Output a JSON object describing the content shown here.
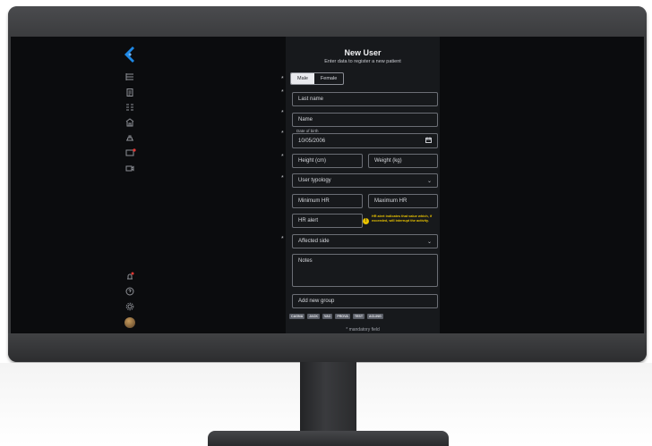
{
  "form": {
    "title": "New User",
    "subtitle": "Enter data to register a new patient",
    "gender_options": [
      "Male",
      "Female"
    ],
    "selected_gender": "Male",
    "required_marker": "*",
    "last_name_placeholder": "Last name",
    "name_placeholder": "Name",
    "date_of_birth_label": "Date of birth",
    "date_of_birth_value": "10/05/2006",
    "height_placeholder": "Height (cm)",
    "weight_placeholder": "Weight (kg)",
    "user_typology_placeholder": "User typology",
    "min_hr_placeholder": "Minimum HR",
    "max_hr_placeholder": "Maximum HR",
    "hr_alert_placeholder": "HR alert",
    "hr_alert_note": "HR alert indicates that value which, if exceeded, will interrupt the activity.",
    "affected_side_placeholder": "Affected side",
    "notes_placeholder": "Notes",
    "add_group_placeholder": "Add new group",
    "groups": [
      "CAGNA",
      "JACK",
      "VAC",
      "PROVA",
      "TEST",
      "ACLING"
    ],
    "footnote": "* mandatory field"
  },
  "icons": {
    "logo": "app-logo-icon",
    "sidebar": [
      "list-icon",
      "clipboard-icon",
      "tasks-icon",
      "building-icon",
      "device-icon",
      "monitor-alert-icon",
      "video-icon"
    ],
    "sidebar_bottom": [
      "bell-alert-icon",
      "help-icon",
      "settings-icon",
      "avatar"
    ]
  },
  "colors": {
    "accent": "#1e88e5",
    "alert": "#e8c200",
    "notification": "#e53935"
  }
}
